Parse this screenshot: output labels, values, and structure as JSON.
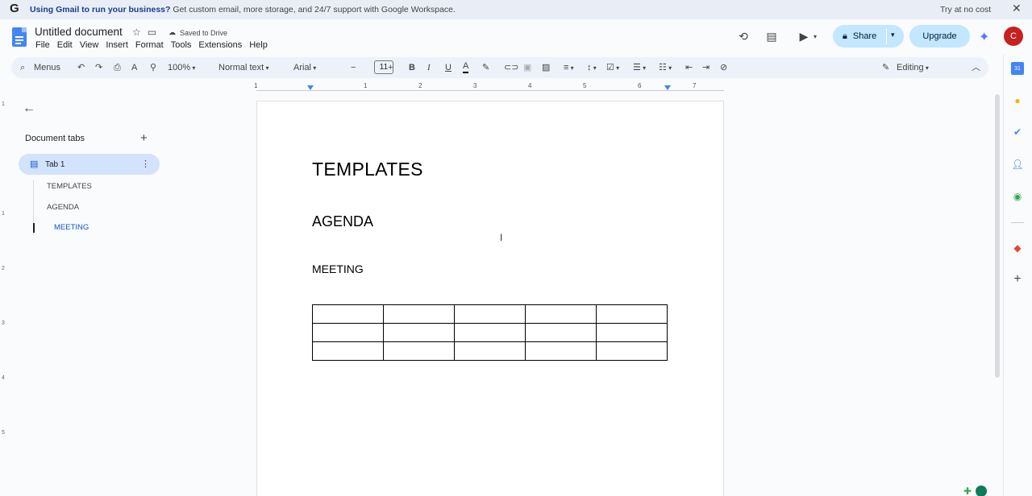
{
  "banner": {
    "bold": "Using Gmail to run your business?",
    "text": " Get custom email, more storage, and 24/7 support with Google Workspace.",
    "try": "Try at no cost",
    "close": "✕",
    "logo": "G"
  },
  "header": {
    "title": "Untitled document",
    "saved": "Saved to Drive",
    "menu": [
      "File",
      "Edit",
      "View",
      "Insert",
      "Format",
      "Tools",
      "Extensions",
      "Help"
    ],
    "share": "Share",
    "upgrade": "Upgrade",
    "avatar": "C"
  },
  "toolbar": {
    "search": "Menus",
    "zoom": "100%",
    "style": "Normal text",
    "font": "Arial",
    "font_size": "11",
    "mode": "Editing"
  },
  "ruler": {
    "numbers": [
      "1",
      "1",
      "2",
      "3",
      "4",
      "5",
      "6",
      "7"
    ]
  },
  "vruler": {
    "numbers": [
      "1",
      "1",
      "2",
      "3",
      "4",
      "5"
    ]
  },
  "sidebar": {
    "title": "Document tabs",
    "tab": "Tab 1",
    "outline": [
      "TEMPLATES",
      "AGENDA",
      "MEETING"
    ]
  },
  "document": {
    "heading1": "TEMPLATES",
    "heading2": "AGENDA",
    "heading3": "MEETING",
    "table": {
      "rows": 3,
      "cols": 5
    }
  },
  "colors": {
    "accent": "#0b57d0",
    "share_bg": "#c2e7ff",
    "avatar_bg": "#c5221f"
  }
}
